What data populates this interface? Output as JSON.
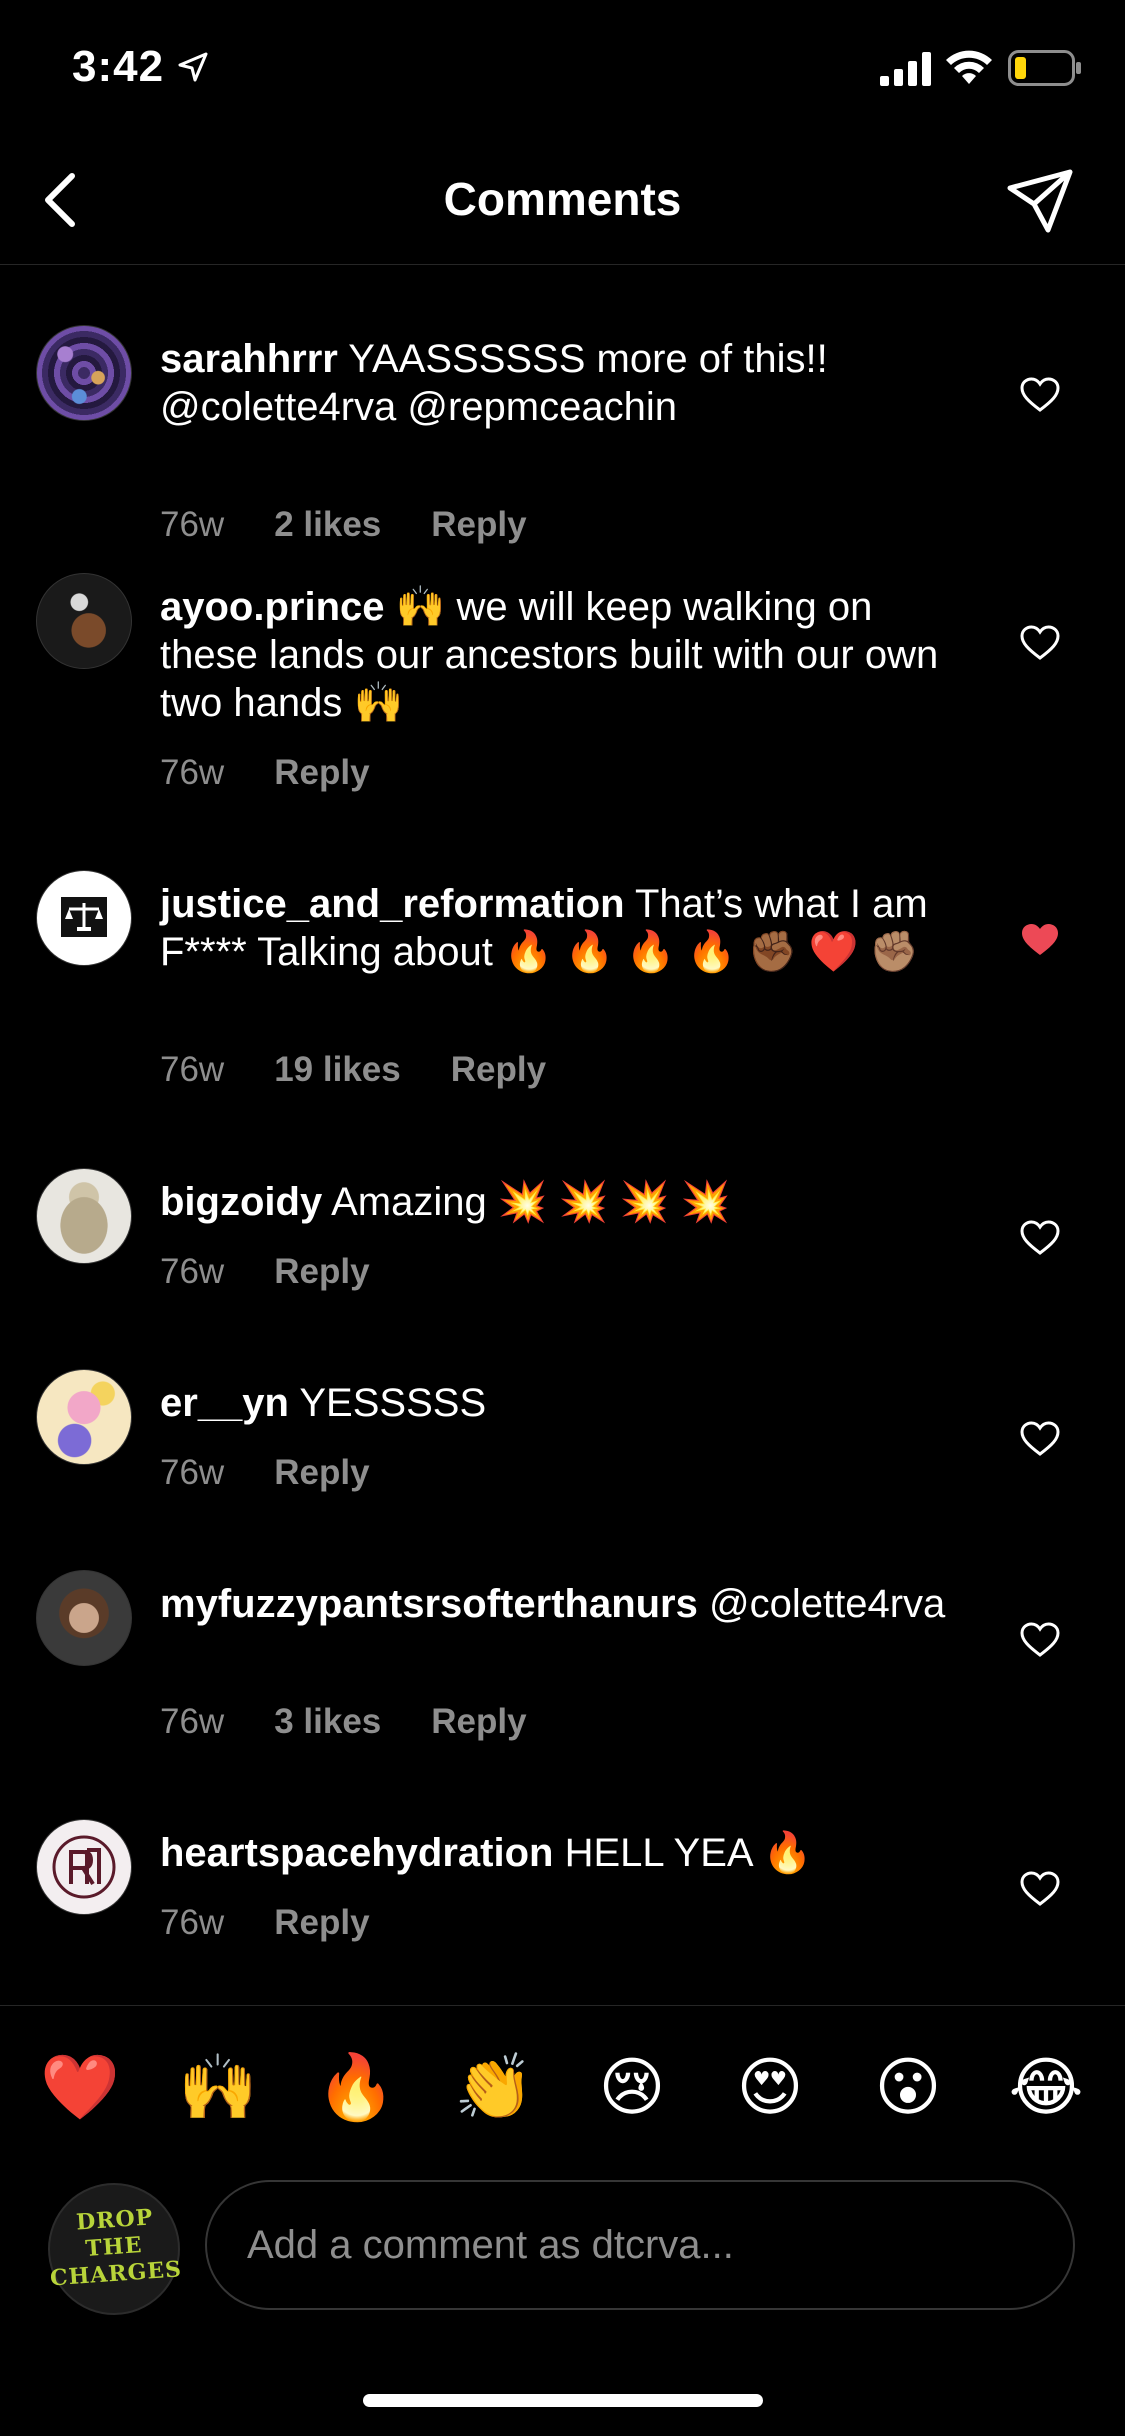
{
  "status": {
    "time": "3:42"
  },
  "header": {
    "title": "Comments"
  },
  "comments": [
    {
      "username": "sarahhrrr",
      "text": " YAASSSSSS more of this!! @colette4rva @repmceachin",
      "emoji": "",
      "age": "76w",
      "likes": "2 likes",
      "reply": "Reply",
      "liked": false
    },
    {
      "username": "ayoo.prince",
      "text": " 🙌 we will keep walking on these lands our ancestors built with our own two hands 🙌",
      "emoji": "",
      "age": "76w",
      "likes": "",
      "reply": "Reply",
      "liked": false
    },
    {
      "username": "justice_and_reformation",
      "text": " That’s what I am F**** Talking about 🔥 🔥 🔥 🔥 ✊🏾 ❤️ ✊🏽",
      "emoji": "",
      "age": "76w",
      "likes": "19 likes",
      "reply": "Reply",
      "liked": true
    },
    {
      "username": "bigzoidy",
      "text": " Amazing 💥 💥 💥 💥",
      "emoji": "",
      "age": "76w",
      "likes": "",
      "reply": "Reply",
      "liked": false
    },
    {
      "username": "er__yn",
      "text": " YESSSSS",
      "emoji": "",
      "age": "76w",
      "likes": "",
      "reply": "Reply",
      "liked": false
    },
    {
      "username": "myfuzzypantsrsofterthanurs",
      "text": " @colette4rva",
      "emoji": "",
      "age": "76w",
      "likes": "3 likes",
      "reply": "Reply",
      "liked": false
    },
    {
      "username": "heartspacehydration",
      "text": " HELL YEA 🔥",
      "emoji": "",
      "age": "76w",
      "likes": "",
      "reply": "Reply",
      "liked": false
    }
  ],
  "quick_emojis": [
    "❤️",
    "🙌",
    "🔥",
    "👏",
    "😢",
    "😍",
    "😮",
    "😂"
  ],
  "composer": {
    "placeholder": "Add a comment as dtcrva...",
    "avatar_text": [
      "DROP",
      "THE",
      "CHARGES"
    ]
  },
  "colors": {
    "liked_heart": "#ed4956",
    "secondary_text": "#8e8e8e",
    "avatar_text": "#b8d43a"
  }
}
